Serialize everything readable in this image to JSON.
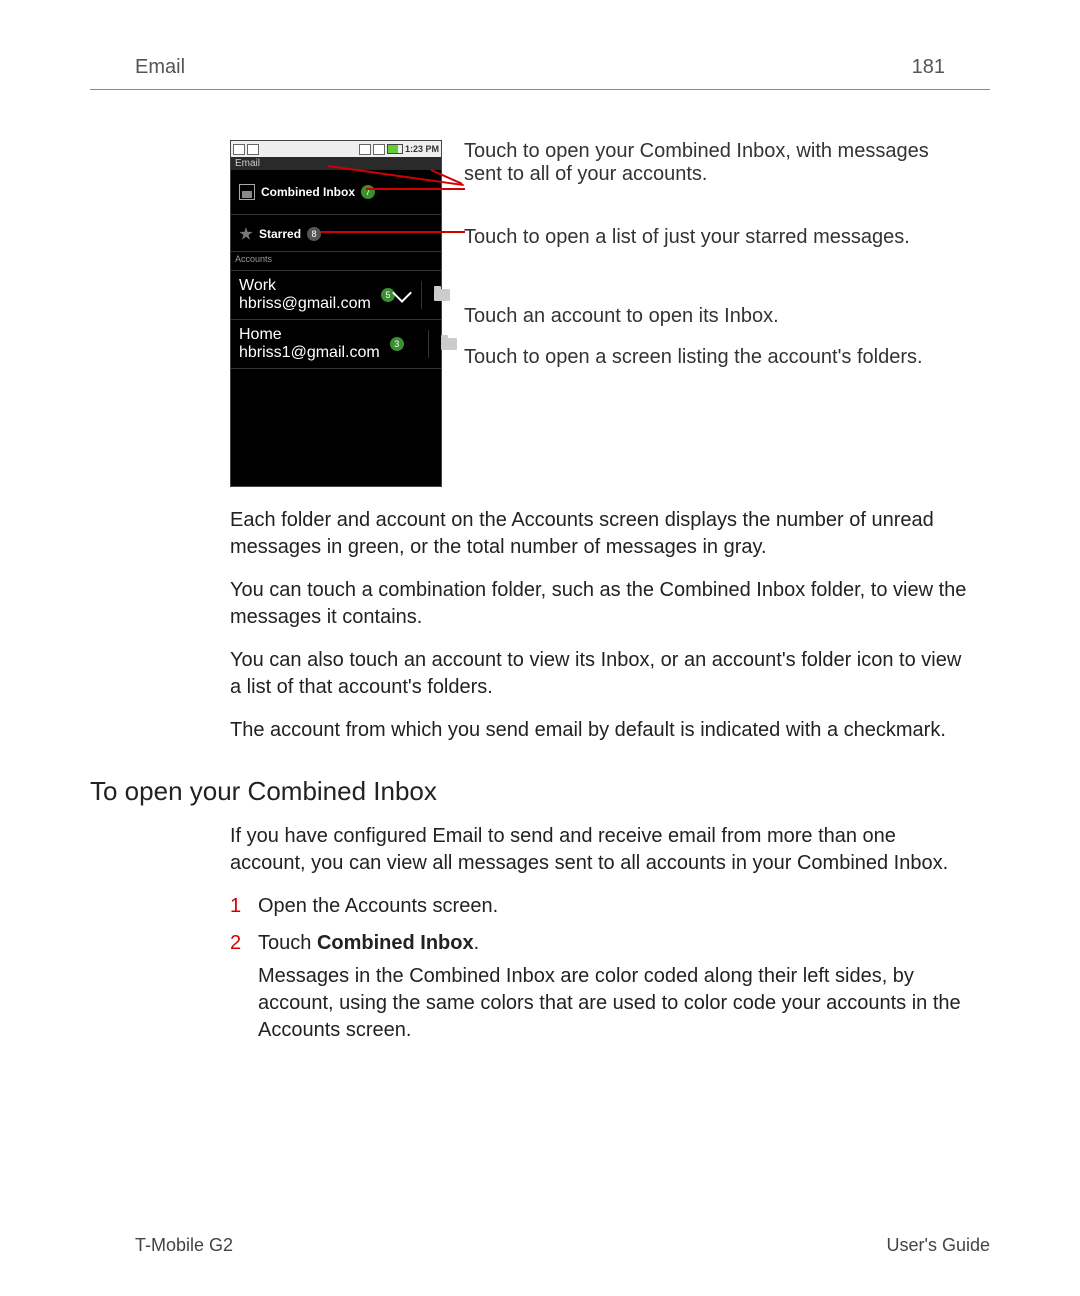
{
  "header": {
    "section": "Email",
    "page_no": "181"
  },
  "phone": {
    "time": "1:23 PM",
    "app_title": "Email",
    "combined_label": "Combined Inbox",
    "combined_badge": "7",
    "starred_label": "Starred",
    "starred_badge": "8",
    "accounts_header": "Accounts",
    "accounts": [
      {
        "name": "Work",
        "email": "hbriss@gmail.com",
        "badge": "5",
        "default": true
      },
      {
        "name": "Home",
        "email": "hbriss1@gmail.com",
        "badge": "3",
        "default": false
      }
    ]
  },
  "callouts": {
    "c1": "Touch to open your Combined Inbox, with messages sent to all of your accounts.",
    "c2": "Touch to open a list of just your starred messages.",
    "c3": "Touch an account to open its Inbox.",
    "c4": "Touch to open a screen listing the account's folders."
  },
  "body": {
    "p1": "Each folder and account on the Accounts screen displays the number of unread messages in green, or the total number of messages in gray.",
    "p2": "You can touch a combination folder, such as the Combined Inbox folder, to view the messages it contains.",
    "p3": "You can also touch an account to view its Inbox, or an account's folder icon to view a list of that account's folders.",
    "p4": "The account from which you send email by default is indicated with a checkmark.",
    "h2": "To open your Combined Inbox",
    "p5": "If you have configured Email to send and receive email from more than one account, you can view all messages sent to all accounts in your Combined Inbox.",
    "step1": "Open the Accounts screen.",
    "step2_pre": "Touch ",
    "step2_b": "Combined Inbox",
    "step2_post": ".",
    "p6": "Messages in the Combined Inbox are color coded along their left sides, by account, using the same colors that are used to color code your accounts in the Accounts screen."
  },
  "footer": {
    "left": "T-Mobile G2",
    "right": "User's Guide"
  }
}
